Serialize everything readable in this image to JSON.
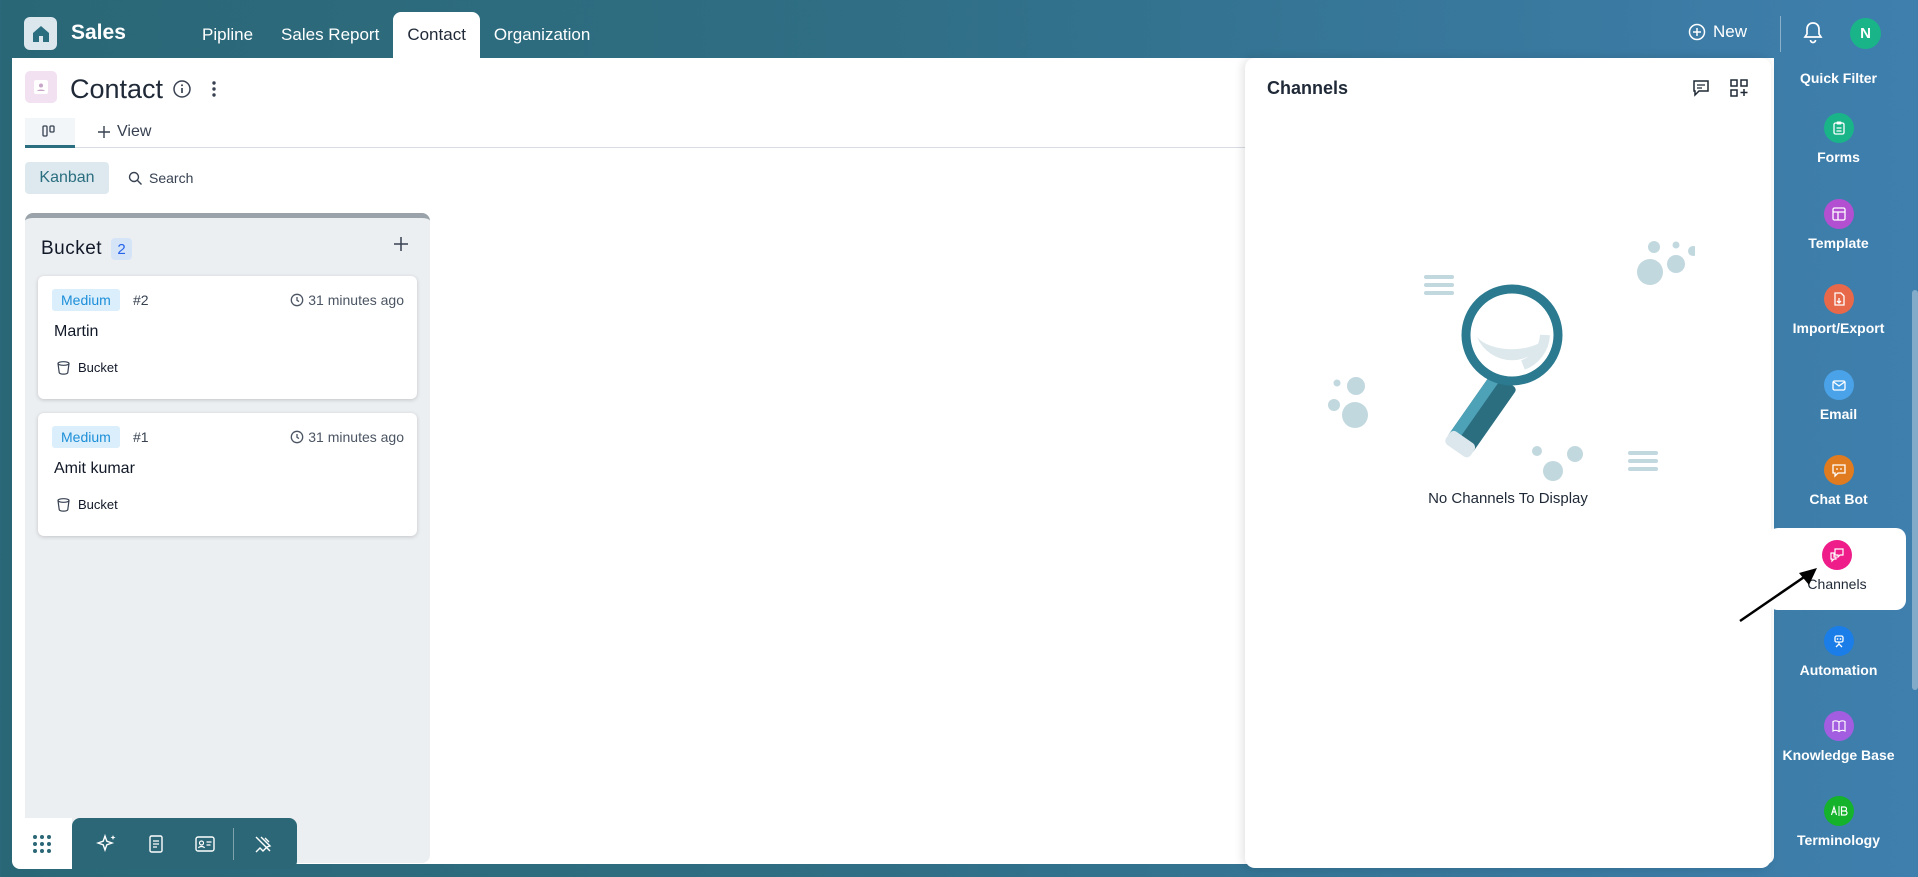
{
  "app": {
    "name": "Sales"
  },
  "nav": {
    "tabs": [
      {
        "label": "Pipline",
        "active": false
      },
      {
        "label": "Sales Report",
        "active": false
      },
      {
        "label": "Contact",
        "active": true
      },
      {
        "label": "Organization",
        "active": false
      }
    ],
    "new_label": "New",
    "avatar_initial": "N"
  },
  "page": {
    "title": "Contact",
    "add_view_label": "View",
    "kanban_label": "Kanban",
    "search_label": "Search"
  },
  "column": {
    "title": "Bucket",
    "count": "2",
    "cards": [
      {
        "priority": "Medium",
        "id": "#2",
        "time": "31 minutes ago",
        "name": "Martin",
        "bucket": "Bucket"
      },
      {
        "priority": "Medium",
        "id": "#1",
        "time": "31 minutes ago",
        "name": "Amit kumar",
        "bucket": "Bucket"
      }
    ]
  },
  "channels_panel": {
    "title": "Channels",
    "empty_message": "No Channels To Display"
  },
  "sidebar": {
    "items": [
      {
        "label": "Quick Filter",
        "icon": "filter-icon",
        "color": ""
      },
      {
        "label": "Forms",
        "icon": "clipboard-icon",
        "color": "#1ab489"
      },
      {
        "label": "Template",
        "icon": "template-icon",
        "color": "#b34fd1"
      },
      {
        "label": "Import/Export",
        "icon": "file-transfer-icon",
        "color": "#e8684a"
      },
      {
        "label": "Email",
        "icon": "mail-icon",
        "color": "#4aa3e8"
      },
      {
        "label": "Chat Bot",
        "icon": "chatbot-icon",
        "color": "#e07b1f"
      },
      {
        "label": "Channels",
        "icon": "channels-icon",
        "color": "#ee1d8a"
      },
      {
        "label": "Automation",
        "icon": "robot-icon",
        "color": "#1a7de8"
      },
      {
        "label": "Knowledge Base",
        "icon": "book-icon",
        "color": "#a35de0"
      },
      {
        "label": "Terminology",
        "icon": "ab-icon",
        "color": "#14b32b"
      }
    ]
  }
}
